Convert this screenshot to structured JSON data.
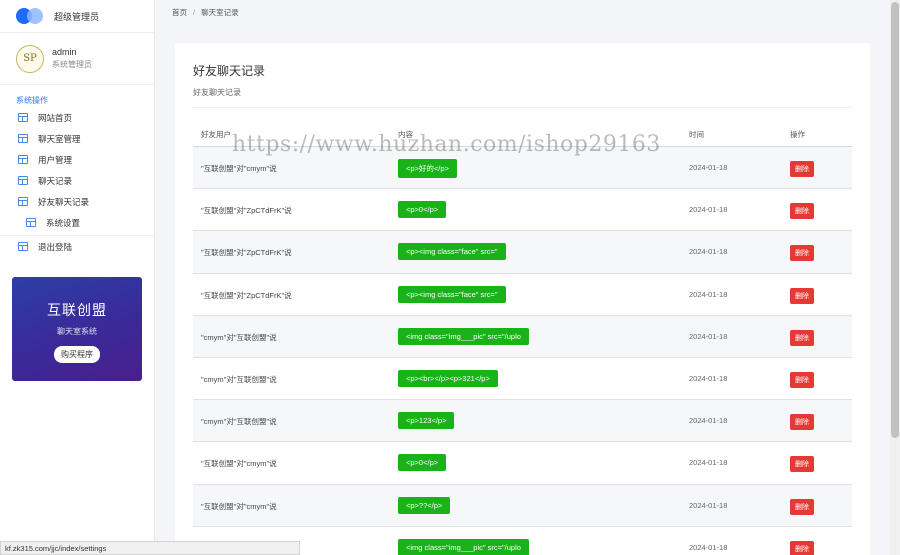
{
  "brand": {
    "title": "超级管理员"
  },
  "user": {
    "avatar_text": "SP",
    "name": "admin",
    "role": "系统管理员"
  },
  "sidebar": {
    "section_title": "系统操作",
    "items": [
      {
        "label": "网站首页"
      },
      {
        "label": "聊天室管理"
      },
      {
        "label": "用户管理"
      },
      {
        "label": "聊天记录"
      },
      {
        "label": "好友聊天记录"
      },
      {
        "label": "系统设置"
      },
      {
        "label": "退出登陆"
      }
    ]
  },
  "promo": {
    "title": "互联创盟",
    "subtitle": "聊天室系统",
    "button": "购买程序"
  },
  "breadcrumb": {
    "home": "首页",
    "separator": "/",
    "current": "聊天室记录"
  },
  "page": {
    "title": "好友聊天记录",
    "subtitle": "好友聊天记录"
  },
  "table": {
    "headers": {
      "user": "好友用户",
      "content": "内容",
      "time": "时间",
      "action": "操作"
    },
    "rows": [
      {
        "user": "\"互联创盟\"对\"cmym\"说",
        "content": "<p>好的</p>",
        "time": "2024-01-18",
        "action": "删除"
      },
      {
        "user": "\"互联创盟\"对\"ZpCTdFrK\"说",
        "content": "<p>0</p>",
        "time": "2024-01-18",
        "action": "删除"
      },
      {
        "user": "\"互联创盟\"对\"ZpCTdFrK\"说",
        "content": "<p><img class=\"face\" src=\"",
        "time": "2024-01-18",
        "action": "删除"
      },
      {
        "user": "\"互联创盟\"对\"ZpCTdFrK\"说",
        "content": "<p><img class=\"face\" src=\"",
        "time": "2024-01-18",
        "action": "删除"
      },
      {
        "user": "\"cmym\"对\"互联创盟\"说",
        "content": "<img class=\"img___pic\" src=\"/uplo",
        "time": "2024-01-18",
        "action": "删除"
      },
      {
        "user": "\"cmym\"对\"互联创盟\"说",
        "content": "<p><br></p><p>321</p>",
        "time": "2024-01-18",
        "action": "删除"
      },
      {
        "user": "\"cmym\"对\"互联创盟\"说",
        "content": "<p>123</p>",
        "time": "2024-01-18",
        "action": "删除"
      },
      {
        "user": "\"互联创盟\"对\"cmym\"说",
        "content": "<p>0</p>",
        "time": "2024-01-18",
        "action": "删除"
      },
      {
        "user": "\"互联创盟\"对\"cmym\"说",
        "content": "<p>??</p>",
        "time": "2024-01-18",
        "action": "删除"
      },
      {
        "user": "",
        "content": "<img class=\"img___pic\" src=\"/uplo",
        "time": "2024-01-18",
        "action": "删除"
      }
    ]
  },
  "watermark": "https://www.huzhan.com/ishop29163",
  "status_url": "kf.zk315.com/jjc/index/settings",
  "colors": {
    "accent": "#2979ff",
    "content_badge": "#19b219",
    "delete_button": "#e53935"
  }
}
